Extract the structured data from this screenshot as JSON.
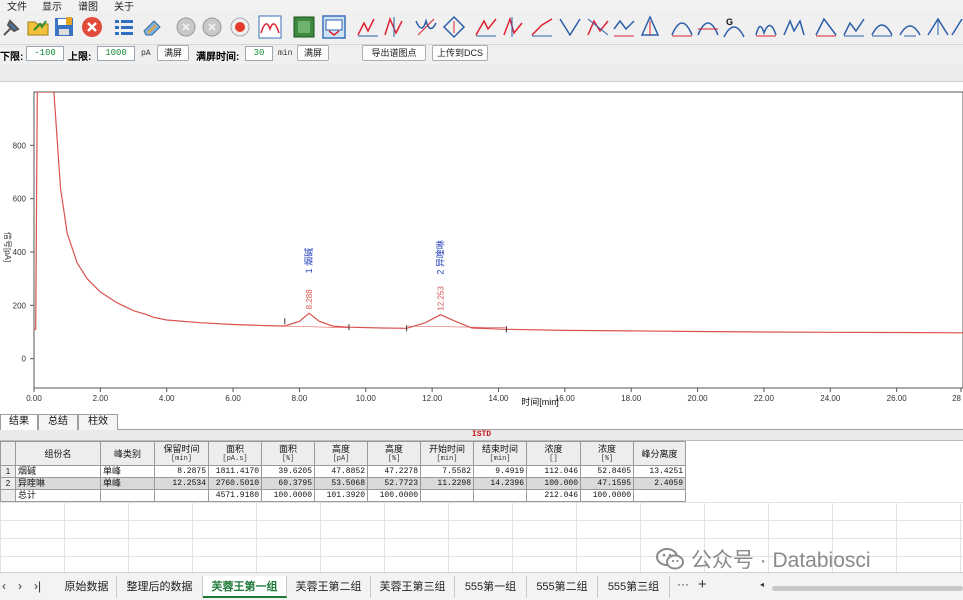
{
  "menu": [
    "文件",
    "显示",
    "谱图",
    "关于"
  ],
  "toolbar_icons": [
    "pin-icon",
    "open-folder-icon",
    "save-icon",
    "close-red-icon",
    "list-icon",
    "eraser-icon",
    "circle-grey-icon",
    "circle-grey2-icon",
    "record-icon",
    "peak-shape-icon",
    "green-box-icon",
    "screen-select-icon",
    "integrate-icon-1",
    "integrate-icon-2",
    "integrate-icon-3",
    "integrate-icon-4",
    "integrate-icon-5",
    "integrate-icon-6",
    "integrate-icon-7",
    "integrate-icon-8",
    "integrate-icon-9",
    "integrate-icon-10",
    "integrate-icon-11",
    "integrate-icon-12",
    "integrate-icon-13",
    "ga-icon",
    "integrate-icon-14",
    "integrate-icon-15",
    "integrate-icon-16",
    "integrate-icon-17",
    "integrate-icon-18",
    "integrate-icon-19",
    "integrate-icon-20",
    "integrate-icon-21"
  ],
  "params": {
    "lower_label": "下限:",
    "lower_value": "-100",
    "upper_label": "上限:",
    "upper_value": "1000",
    "unit_pa": "pA",
    "fullscreen1": "满屏",
    "fs_time_label": "满屏时间:",
    "fs_time_value": "30",
    "unit_min": "min",
    "fullscreen2": "满屏",
    "export_btn": "导出谱图点",
    "upload_btn": "上传到DCS"
  },
  "chart_data": {
    "type": "line",
    "ylabel": "信号[pA]",
    "xlabel": "时间[min]",
    "xlim": [
      0,
      28
    ],
    "ylim": [
      -110,
      1000
    ],
    "x_ticks": [
      "0.00",
      "2.00",
      "4.00",
      "6.00",
      "8.00",
      "10.00",
      "12.00",
      "14.00",
      "16.00",
      "18.00",
      "20.00",
      "22.00",
      "24.00",
      "26.00",
      "28"
    ],
    "y_ticks": [
      "0",
      "200",
      "400",
      "600",
      "800"
    ],
    "y_tick_values": [
      0,
      200,
      400,
      600,
      800
    ],
    "series": [
      {
        "x": [
          0,
          0.05,
          0.1,
          0.15,
          0.2,
          0.6,
          0.8,
          1.0,
          1.3,
          1.6,
          2.0,
          2.5,
          3.0,
          3.4,
          3.6,
          4.0,
          5.0,
          6.0,
          7.0,
          7.55,
          8.0,
          8.29,
          8.6,
          9.0,
          9.5,
          10.5,
          11.23,
          11.8,
          12.25,
          12.7,
          13.2,
          14.24,
          16,
          18,
          20,
          22,
          24,
          26,
          28
        ],
        "y": [
          110,
          110,
          1000,
          1000,
          1000,
          1000,
          640,
          470,
          360,
          300,
          250,
          210,
          180,
          165,
          155,
          145,
          135,
          128,
          124,
          122,
          140,
          170,
          140,
          122,
          118,
          115,
          114,
          135,
          165,
          140,
          115,
          110,
          106,
          104,
          102,
          100,
          99,
          98,
          97
        ]
      }
    ],
    "peaks": [
      {
        "rt": "8.288",
        "label": "1 烟碱",
        "x": 8.288,
        "y": 170
      },
      {
        "rt": "12.253",
        "label": "2 异喹啉",
        "x": 12.253,
        "y": 165
      }
    ],
    "baseline_markers": [
      7.5582,
      9.4919,
      11.2298,
      14.2396
    ],
    "grid": false
  },
  "result_tabs": [
    "结果",
    "总结",
    "柱效"
  ],
  "istd_label": "ISTD",
  "table": {
    "headers": [
      {
        "name": "组份名",
        "unit": ""
      },
      {
        "name": "峰类别",
        "unit": ""
      },
      {
        "name": "保留时间",
        "unit": "[min]"
      },
      {
        "name": "面积",
        "unit": "[pA.s]"
      },
      {
        "name": "面积",
        "unit": "[%]"
      },
      {
        "name": "高度",
        "unit": "[pA]"
      },
      {
        "name": "高度",
        "unit": "[%]"
      },
      {
        "name": "开始时间",
        "unit": "[min]"
      },
      {
        "name": "结束时间",
        "unit": "[min]"
      },
      {
        "name": "浓度",
        "unit": "[]"
      },
      {
        "name": "浓度",
        "unit": "[%]"
      },
      {
        "name": "峰分离度",
        "unit": ""
      }
    ],
    "rows": [
      {
        "idx": "1",
        "cells": [
          "烟碱",
          "单峰",
          "8.2875",
          "1811.4170",
          "39.6205",
          "47.8852",
          "47.2278",
          "7.5582",
          "9.4919",
          "112.046",
          "52.8405",
          "13.4251"
        ]
      },
      {
        "idx": "2",
        "cells": [
          "异喹啉",
          "单峰",
          "12.2534",
          "2760.5010",
          "60.3795",
          "53.5068",
          "52.7723",
          "11.2298",
          "14.2396",
          "100.000",
          "47.1595",
          "2.4059"
        ]
      },
      {
        "idx": "",
        "cells": [
          "总计",
          "",
          "",
          "4571.9180",
          "100.0000",
          "101.3920",
          "100.0000",
          "",
          "",
          "212.046",
          "100.0000",
          ""
        ]
      }
    ]
  },
  "watermark": {
    "icon": "wechat-icon",
    "text": "公众号 · Databiosci"
  },
  "sheets": {
    "tabs": [
      "原始数据",
      "整理后的数据",
      "芙蓉王第一组",
      "芙蓉王第二组",
      "芙蓉王第三组",
      "555第一组",
      "555第二组",
      "555第三组"
    ],
    "active_index": 2,
    "more": "···",
    "add": "+"
  }
}
